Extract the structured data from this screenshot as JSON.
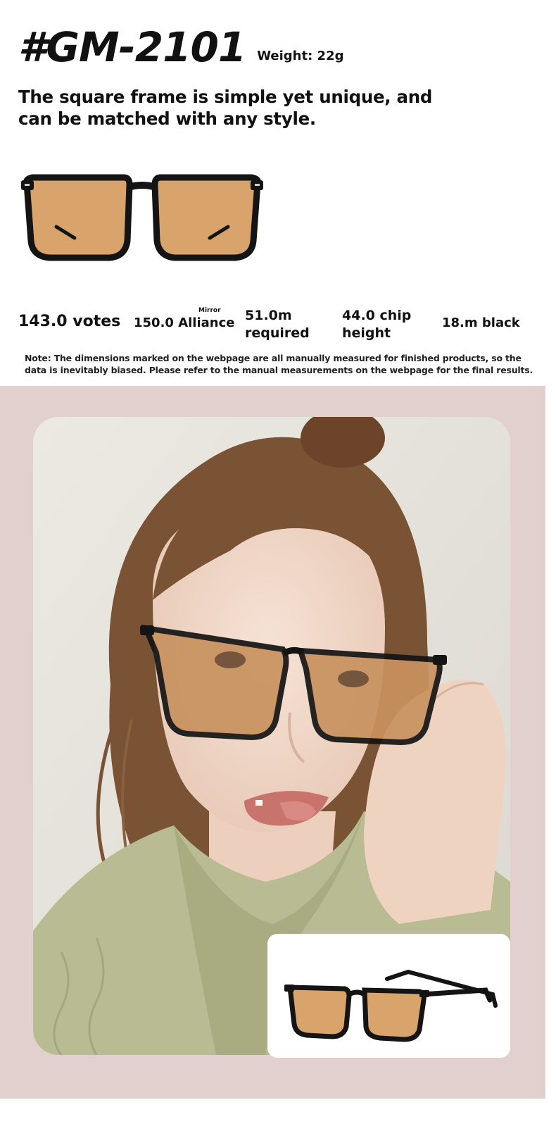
{
  "product": {
    "model": "#GM-2101",
    "weight": "Weight: 22g",
    "tagline": "The square frame is simple yet unique, and can be matched with any style."
  },
  "specs": {
    "votes": "143.0 votes",
    "alliance": "150.0 Alliance",
    "mirror": "Mirror",
    "required_value": "51.0m",
    "required_label": "required",
    "chip_value": "44.0 chip",
    "chip_label": "height",
    "black": "18.m black"
  },
  "note": "Note: The dimensions marked on the webpage are all manually measured for finished products, so the data is inevitably biased. Please refer to the manual measurements on the webpage for the final results.",
  "colors": {
    "background_pink": "#e2d0ce",
    "frame": "#141414",
    "lens": "#d9a46c",
    "sweater": "#b9bb92",
    "hair": "#7a5234",
    "skin": "#f1d9c8"
  },
  "images": {
    "hero": "black square sunglasses with amber lenses, front view",
    "model_photo": "woman in sage knit sweater wearing the sunglasses",
    "inset": "sunglasses three-quarter view"
  }
}
